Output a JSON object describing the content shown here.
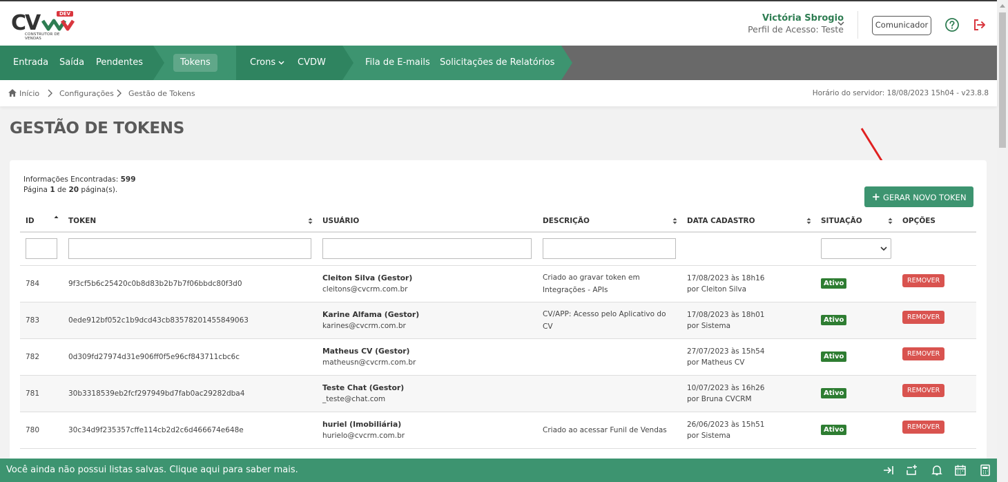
{
  "logo": {
    "text": "CV",
    "badge": "DEV",
    "tagline": "CONSTRUTOR DE VENDAS"
  },
  "header": {
    "user_name": "Victória Sbrogio",
    "user_profile": "Perfil de Acesso: Teste",
    "comunicador_label": "Comunicador"
  },
  "nav": {
    "items": [
      {
        "label": "Entrada"
      },
      {
        "label": "Saída"
      },
      {
        "label": "Pendentes"
      },
      {
        "label": "Tokens"
      },
      {
        "label": "Crons"
      },
      {
        "label": "CVDW"
      },
      {
        "label": "Fila de E-mails"
      },
      {
        "label": "Solicitações de Relatórios"
      }
    ]
  },
  "breadcrumb": {
    "items": [
      {
        "label": "Início"
      },
      {
        "label": "Configurações"
      },
      {
        "label": "Gestão de Tokens"
      }
    ],
    "server_time": "Horário do servidor: 18/08/2023 15h04 - v23.8.8"
  },
  "page": {
    "title": "GESTÃO DE TOKENS"
  },
  "info": {
    "found_label": "Informações Encontradas:",
    "found_count": "599",
    "page_prefix": "Página",
    "page_current": "1",
    "page_of": "de",
    "page_total": "20",
    "page_suffix": "página(s)."
  },
  "buttons": {
    "new_token": "GERAR NOVO TOKEN",
    "remove": "REMOVER"
  },
  "table": {
    "columns": [
      "ID",
      "TOKEN",
      "USUÁRIO",
      "DESCRIÇÃO",
      "DATA CADASTRO",
      "SITUAÇÃO",
      "OPÇÕES"
    ],
    "rows": [
      {
        "id": "784",
        "token": "9f3cf5b6c25420c0b8d83b2b7b7f06bbdc80f3d0",
        "user_name": "Cleiton Silva (Gestor)",
        "user_email": "cleitons@cvcrm.com.br",
        "desc1": "Criado ao gravar token em",
        "desc2": "Integrações - APIs",
        "date": "17/08/2023 às 18h16",
        "by": "por Cleiton Silva",
        "status": "Ativo"
      },
      {
        "id": "783",
        "token": "0ede912bf052c1b9dcd43cb83578201455849063",
        "user_name": "Karine Alfama (Gestor)",
        "user_email": "karines@cvcrm.com.br",
        "desc1": "CV/APP: Acesso pelo Aplicativo do CV",
        "desc2": "",
        "date": "17/08/2023 às 18h01",
        "by": "por Sistema",
        "status": "Ativo"
      },
      {
        "id": "782",
        "token": "0d309fd27974d31e906ff0f5e96cf843711cbc6c",
        "user_name": "Matheus CV (Gestor)",
        "user_email": "matheusn@cvcrm.com.br",
        "desc1": "",
        "desc2": "",
        "date": "27/07/2023 às 15h54",
        "by": "por Matheus CV",
        "status": "Ativo"
      },
      {
        "id": "781",
        "token": "30b3318539eb2fcf297949bd7fab0ac29282dba4",
        "user_name": "Teste Chat (Gestor)",
        "user_email": "_teste@chat.com",
        "desc1": "",
        "desc2": "",
        "date": "10/07/2023 às 16h26",
        "by": "por Bruna CVCRM",
        "status": "Ativo"
      },
      {
        "id": "780",
        "token": "30c34d9f235357cffe114cb2d2c6d466674e648e",
        "user_name": "huriel (Imobiliária)",
        "user_email": "hurielo@cvcrm.com.br",
        "desc1": "Criado ao acessar Funil de Vendas",
        "desc2": "",
        "date": "26/06/2023 às 15h51",
        "by": "por Sistema",
        "status": "Ativo"
      }
    ]
  },
  "bottombar": {
    "message": "Você ainda não possui listas salvas. Clique aqui para saber mais."
  },
  "colors": {
    "green": "#3d9470",
    "dark_green": "#2e7d52",
    "nav_gray": "#696969",
    "remove_red": "#d9534f",
    "badge_green": "#2e7d32"
  }
}
